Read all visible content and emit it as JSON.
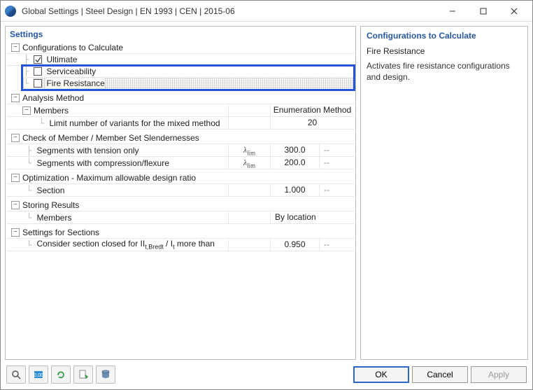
{
  "window": {
    "title": "Global Settings | Steel Design | EN 1993 | CEN | 2015-06"
  },
  "panel_titles": {
    "settings": "Settings",
    "configs": "Configurations to Calculate"
  },
  "tree": {
    "configs": {
      "label": "Configurations to Calculate",
      "ultimate": "Ultimate",
      "serviceability": "Serviceability",
      "fire_resistance": "Fire Resistance"
    },
    "analysis": {
      "label": "Analysis Method",
      "members": "Members",
      "col_header": "Enumeration Method",
      "limit_variants": "Limit number of variants for the mixed method",
      "limit_variants_val": "20"
    },
    "slenderness": {
      "label": "Check of Member / Member Set Slendernesses",
      "tension": "Segments with tension only",
      "compression": "Segments with compression/flexure",
      "tension_val": "300.0",
      "compression_val": "200.0",
      "unit": "--"
    },
    "optimization": {
      "label": "Optimization - Maximum allowable design ratio",
      "section": "Section",
      "section_val": "1.000",
      "unit": "--"
    },
    "storing": {
      "label": "Storing Results",
      "members": "Members",
      "members_val": "By location"
    },
    "sections_settings": {
      "label": "Settings for Sections",
      "closed_prefix": "Consider section closed for I",
      "closed_suffix": " more than",
      "val": "0.950",
      "unit": "--"
    }
  },
  "right_panel": {
    "heading": "Fire Resistance",
    "desc": "Activates fire resistance configurations and design."
  },
  "buttons": {
    "ok": "OK",
    "cancel": "Cancel",
    "apply": "Apply"
  }
}
